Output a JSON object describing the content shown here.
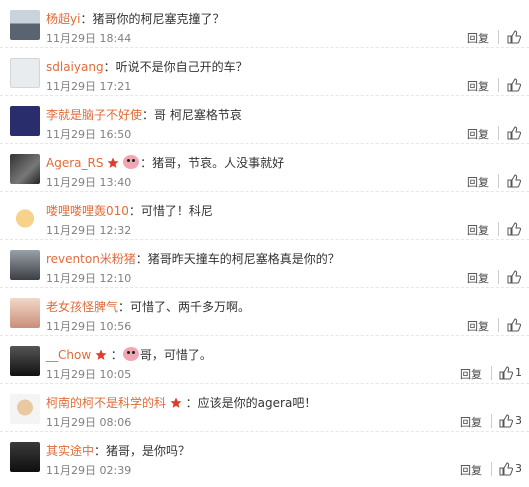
{
  "comments": [
    {
      "user": "杨超yi",
      "text": "：猪哥你的柯尼塞克撞了？",
      "time": "11月29日 18:44",
      "reply": "回复",
      "likes": ""
    },
    {
      "user": "sdlaiyang",
      "text": "：听说不是你自己开的车？",
      "time": "11月29日 17:21",
      "reply": "回复",
      "likes": ""
    },
    {
      "user": "李就是脑子不好使",
      "text": "：哥 柯尼塞格节哀",
      "time": "11月29日 16:50",
      "reply": "回复",
      "likes": ""
    },
    {
      "user": "Agera_RS",
      "text": "：猪哥，节哀。人没事就好",
      "time": "11月29日 13:40",
      "reply": "回复",
      "likes": ""
    },
    {
      "user": "喽哩喽哩轰010",
      "text": "：可惜了！科尼",
      "time": "11月29日 12:32",
      "reply": "回复",
      "likes": ""
    },
    {
      "user": "reventon米粉猪",
      "text": "：猪哥昨天撞车的柯尼塞格真是你的？",
      "time": "11月29日 12:10",
      "reply": "回复",
      "likes": ""
    },
    {
      "user": "老女孩怪脾气",
      "text": "：可惜了、两千多万啊。",
      "time": "11月29日 10:56",
      "reply": "回复",
      "likes": ""
    },
    {
      "user": "__Chow",
      "text": "哥，可惜了。",
      "prefix": "：",
      "time": "11月29日 10:05",
      "reply": "回复",
      "likes": "1"
    },
    {
      "user": "柯南的柯不是科学的科",
      "text": "：应该是你的agera吧！",
      "time": "11月29日 08:06",
      "reply": "回复",
      "likes": "3"
    },
    {
      "user": "其实途中",
      "text": "：猪哥，是你吗？",
      "time": "11月29日 02:39",
      "reply": "回复",
      "likes": "3"
    }
  ],
  "colors": {
    "username": "#e06b3a",
    "time": "#808080",
    "badge": "#e03c2c"
  },
  "icons": {
    "like": "thumbs-up-icon",
    "badge": "star-badge-icon",
    "emoticon": "pig-face-icon"
  }
}
